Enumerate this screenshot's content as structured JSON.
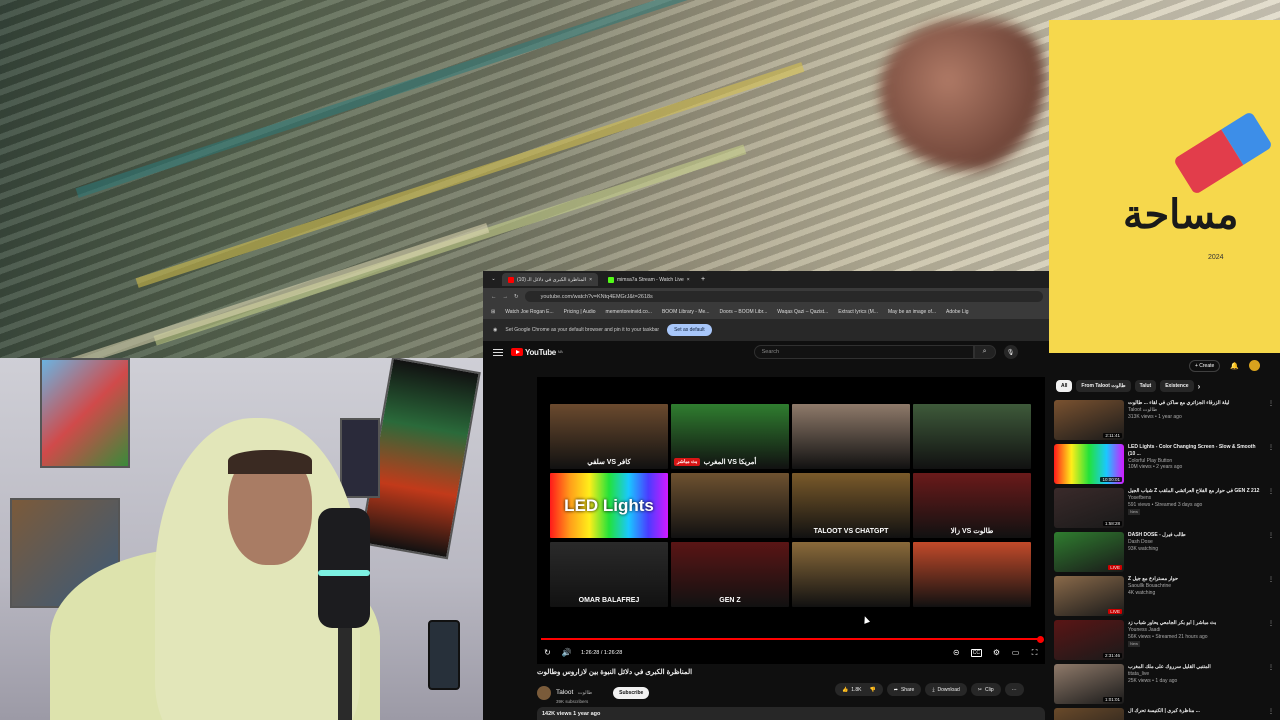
{
  "thumbnail": {
    "title": "مساحة",
    "year": "2024"
  },
  "browser": {
    "tabs": [
      {
        "label": "(10) المناظرة الكبرى في دلائل الـ"
      },
      {
        "label": "mimsa7a Stream - Watch Live"
      }
    ],
    "new_tab": "+",
    "url": "youtube.com/watch?v=KNtq4EMGrJ&t=2618s",
    "bookmarks": [
      "Watch Joe Rogan E...",
      "Pricing | Audio",
      "mementoreinvid.co...",
      "BOOM Library - Me...",
      "Doors – BOOM Libr...",
      "Waqas Qazi – Qazist...",
      "Extract lyrics (M...",
      "May be an image of...",
      "Adobe Lig"
    ],
    "notice_text": "Set Google Chrome as your default browser and pin it to your taskbar",
    "notice_button": "Set as default"
  },
  "youtube": {
    "logo": "YouTube",
    "region": "MA",
    "search_placeholder": "Search",
    "player": {
      "cells": [
        {
          "label": "سلفي VS كافر",
          "tag": "",
          "bg": "#6b4a2e"
        },
        {
          "label": "المغرب VS أمريكا",
          "tag": "بث مباشر",
          "bg": "#2f7d2f"
        },
        {
          "label": "",
          "tag": "",
          "bg": "#8f7a6a"
        },
        {
          "label": "",
          "tag": "",
          "bg": "#3e5a3a"
        },
        {
          "label": "LED Lights",
          "tag": "",
          "bg": "led"
        },
        {
          "label": "",
          "tag": "",
          "bg": "#6e5230"
        },
        {
          "label": "TALOOT VS CHATGPT",
          "tag": "",
          "bg": "#7a5a2a"
        },
        {
          "label": "زالا VS طالوت",
          "tag": "",
          "bg": "#6a1a1a"
        },
        {
          "label": "OMAR BALAFREJ",
          "tag": "",
          "bg": "#2a2a2a"
        },
        {
          "label": "GEN Z",
          "tag": "",
          "bg": "#5a1515"
        },
        {
          "label": "",
          "tag": "",
          "bg": "#8a6a3a"
        },
        {
          "label": "",
          "tag": "",
          "bg": "#c24a2a"
        }
      ],
      "progress": 1.0,
      "time": "1:26:28 / 1:26:28"
    },
    "video_title": "المناظرة الكبرى في دلائل النبوة بين لازاروس وطالوت",
    "channel": {
      "name": "Taloot",
      "arabic": "طالوت",
      "subscribers": "39K subscribers",
      "subscribe": "Subscribe"
    },
    "actions": {
      "likes": "1.8K",
      "share": "Share",
      "download": "Download",
      "clip": "Clip",
      "more": "···"
    },
    "views": "142K views  1 year ago"
  },
  "sidebar": {
    "create": "+ Create",
    "chips": [
      {
        "label": "All",
        "selected": true
      },
      {
        "label": "From Taloot طالوت",
        "selected": false
      },
      {
        "label": "Talut",
        "selected": false
      },
      {
        "label": "Existence",
        "selected": false
      }
    ],
    "items": [
      {
        "title": "ليلة الزرقاء الجزائري مع ساكن في لقاء ... طالوت",
        "channel": "Taloot طالوت",
        "stats": "313K views • 1 year ago",
        "duration": "2:11:41",
        "live": false,
        "new": false,
        "color": "#7a5230"
      },
      {
        "title": "LED Lights - Color Changing Screen - Slow & Smooth (10 ...",
        "channel": "Colorful Play Button",
        "stats": "10M views • 2 years ago",
        "duration": "10:00:01",
        "live": false,
        "new": false,
        "color": "#d21aff"
      },
      {
        "title": "شباب الجيل Z في حوار مع الفلاح العرائشي الملقب GEN Z 212",
        "channel": "Yosefbens",
        "stats": "591 views • Streamed 3 days ago",
        "duration": "1:58:28",
        "live": false,
        "new": true,
        "color": "#3a2a2a"
      },
      {
        "title": "DASH DOSE - طالب فيرل",
        "channel": "Dash Dose",
        "stats": "93K watching",
        "duration": "LIVE",
        "live": true,
        "new": false,
        "color": "#2f7d2f"
      },
      {
        "title": "Z حوار مسترادخ مع جيل",
        "channel": "Saoullk Bouachrine",
        "stats": "4K watching",
        "duration": "LIVE",
        "live": true,
        "new": false,
        "color": "#8a6a4a"
      },
      {
        "title": "بث مباشر | أبو بكر الجامعي يحاور شباب زد",
        "channel": "Youness Jaadi",
        "stats": "56K views • Streamed 21 hours ago",
        "duration": "2:31:46",
        "live": false,
        "new": true,
        "color": "#5a1515"
      },
      {
        "title": "المتنبي القليل سرروك على ملك المغرب",
        "channel": "titata_live",
        "stats": "25K views • 1 day ago",
        "duration": "1:01:01",
        "live": false,
        "new": false,
        "color": "#8f7a6a"
      },
      {
        "title": "مناظرة كبرى | الكنيسة تحرك ال ...",
        "channel": "",
        "stats": "",
        "duration": "",
        "live": false,
        "new": false,
        "color": "#6a4a2a"
      }
    ]
  }
}
